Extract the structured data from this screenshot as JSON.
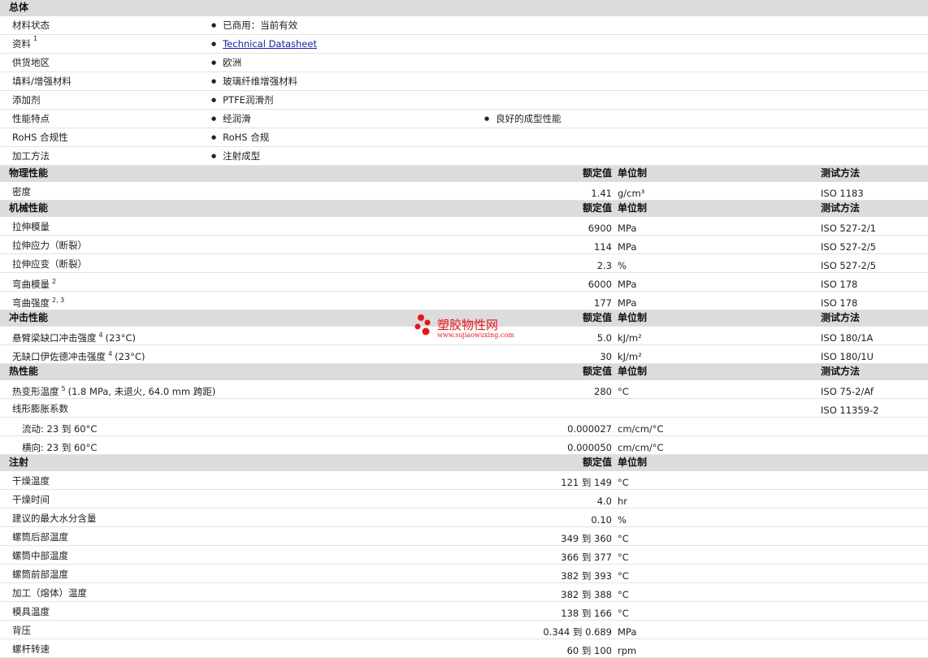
{
  "general": {
    "title": "总体",
    "rows": [
      {
        "label": "材料状态",
        "v1": "已商用：当前有效"
      },
      {
        "label": "资料",
        "sup": "1",
        "v1": "Technical Datasheet",
        "link": true
      },
      {
        "label": "供货地区",
        "v1": "欧洲"
      },
      {
        "label": "填料/增强材料",
        "v1": "玻璃纤维增强材料"
      },
      {
        "label": "添加剂",
        "v1": "PTFE润滑剂"
      },
      {
        "label": "性能特点",
        "v1": "经润滑",
        "v2": "良好的成型性能"
      },
      {
        "label": "RoHS 合规性",
        "v1": "RoHS 合规"
      },
      {
        "label": "加工方法",
        "v1": "注射成型"
      }
    ]
  },
  "headers": {
    "nominal": "额定值",
    "unit": "单位制",
    "method": "测试方法"
  },
  "sections": [
    {
      "title": "物理性能",
      "has_method": true,
      "rows": [
        {
          "label": "密度",
          "value": "1.41",
          "unit": "g/cm³",
          "method": "ISO 1183"
        }
      ]
    },
    {
      "title": "机械性能",
      "has_method": true,
      "rows": [
        {
          "label": "拉伸模量",
          "value": "6900",
          "unit": "MPa",
          "method": "ISO 527-2/1"
        },
        {
          "label": "拉伸应力（断裂）",
          "value": "114",
          "unit": "MPa",
          "method": "ISO 527-2/5"
        },
        {
          "label": "拉伸应变（断裂）",
          "value": "2.3",
          "unit": "%",
          "method": "ISO 527-2/5"
        },
        {
          "label": "弯曲模量",
          "sup": "2",
          "value": "6000",
          "unit": "MPa",
          "method": "ISO 178"
        },
        {
          "label": "弯曲强度",
          "sup": "2, 3",
          "value": "177",
          "unit": "MPa",
          "method": "ISO 178"
        }
      ]
    },
    {
      "title": "冲击性能",
      "has_method": true,
      "rows": [
        {
          "label": "悬臂梁缺口冲击强度",
          "sup": "4",
          "note": "(23°C)",
          "value": "5.0",
          "unit": "kJ/m²",
          "method": "ISO 180/1A"
        },
        {
          "label": "无缺口伊佐德冲击强度",
          "sup": "4",
          "note": "(23°C)",
          "value": "30",
          "unit": "kJ/m²",
          "method": "ISO 180/1U"
        }
      ]
    },
    {
      "title": "热性能",
      "has_method": true,
      "rows": [
        {
          "label": "热变形温度",
          "sup": "5",
          "note": "(1.8 MPa, 未退火, 64.0 mm 跨距)",
          "value": "280",
          "unit": "°C",
          "method": "ISO 75-2/Af"
        },
        {
          "label": "线形膨胀系数",
          "value": "",
          "unit": "",
          "method": "ISO 11359-2"
        },
        {
          "label": "流动: 23 到 60°C",
          "indent": true,
          "value": "0.000027",
          "unit": "cm/cm/°C",
          "method": ""
        },
        {
          "label": "横向: 23 到 60°C",
          "indent": true,
          "value": "0.000050",
          "unit": "cm/cm/°C",
          "method": ""
        }
      ]
    },
    {
      "title": "注射",
      "has_method": false,
      "rows": [
        {
          "label": "干燥温度",
          "value": "121 到 149",
          "unit": "°C"
        },
        {
          "label": "干燥时间",
          "value": "4.0",
          "unit": "hr"
        },
        {
          "label": "建议的最大水分含量",
          "value": "0.10",
          "unit": "%"
        },
        {
          "label": "螺筒后部温度",
          "value": "349 到 360",
          "unit": "°C"
        },
        {
          "label": "螺筒中部温度",
          "value": "366 到 377",
          "unit": "°C"
        },
        {
          "label": "螺筒前部温度",
          "value": "382 到 393",
          "unit": "°C"
        },
        {
          "label": "加工（熔体）温度",
          "value": "382 到 388",
          "unit": "°C"
        },
        {
          "label": "模具温度",
          "value": "138 到 166",
          "unit": "°C"
        },
        {
          "label": "背压",
          "value": "0.344 到 0.689",
          "unit": "MPa"
        },
        {
          "label": "螺杆转速",
          "value": "60 到 100",
          "unit": "rpm"
        }
      ]
    }
  ],
  "watermark": {
    "title": "塑胶物性网",
    "url": "www.sujiaowuxing.com",
    "color": "#e8141c"
  }
}
